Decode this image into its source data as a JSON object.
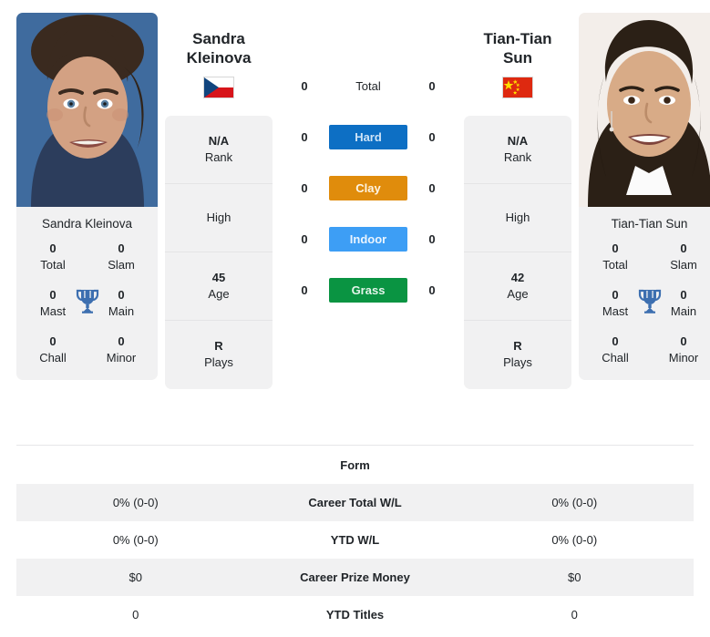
{
  "players": {
    "left": {
      "first_name": "Sandra",
      "last_name": "Kleinova",
      "full_name": "Sandra Kleinova",
      "display_name": "Sandra\nKleinova",
      "flag": "czech-republic-flag",
      "rank": "N/A",
      "rank_label": "Rank",
      "high": "High",
      "age": "45",
      "age_label": "Age",
      "plays": "R",
      "plays_label": "Plays",
      "titles": {
        "total": "0",
        "total_label": "Total",
        "slam": "0",
        "slam_label": "Slam",
        "mast": "0",
        "mast_label": "Mast",
        "main": "0",
        "main_label": "Main",
        "chall": "0",
        "chall_label": "Chall",
        "minor": "0",
        "minor_label": "Minor"
      }
    },
    "right": {
      "first_name": "Tian-Tian",
      "last_name": "Sun",
      "full_name": "Tian-Tian Sun",
      "display_name": "Tian-Tian\nSun",
      "flag": "china-flag",
      "rank": "N/A",
      "rank_label": "Rank",
      "high": "High",
      "age": "42",
      "age_label": "Age",
      "plays": "R",
      "plays_label": "Plays",
      "titles": {
        "total": "0",
        "total_label": "Total",
        "slam": "0",
        "slam_label": "Slam",
        "mast": "0",
        "mast_label": "Mast",
        "main": "0",
        "main_label": "Main",
        "chall": "0",
        "chall_label": "Chall",
        "minor": "0",
        "minor_label": "Minor"
      }
    }
  },
  "surfaces": [
    {
      "label": "Total",
      "left": "0",
      "right": "0",
      "bg": "transparent",
      "fg": "#212529",
      "plain": true
    },
    {
      "label": "Hard",
      "left": "0",
      "right": "0",
      "bg": "#0d6fc4",
      "fg": "#cfe4f7",
      "plain": false
    },
    {
      "label": "Clay",
      "left": "0",
      "right": "0",
      "bg": "#e08c0c",
      "fg": "#fdf4e4",
      "plain": false
    },
    {
      "label": "Indoor",
      "left": "0",
      "right": "0",
      "bg": "#3d9ef5",
      "fg": "#eaf4fe",
      "plain": false
    },
    {
      "label": "Grass",
      "left": "0",
      "right": "0",
      "bg": "#0a9442",
      "fg": "#e4f4ea",
      "plain": false
    }
  ],
  "form_table": {
    "header_label": "Form",
    "rows": [
      {
        "left": "0% (0-0)",
        "label": "Career Total W/L",
        "right": "0% (0-0)"
      },
      {
        "left": "0% (0-0)",
        "label": "YTD W/L",
        "right": "0% (0-0)"
      },
      {
        "left": "$0",
        "label": "Career Prize Money",
        "right": "$0"
      },
      {
        "left": "0",
        "label": "YTD Titles",
        "right": "0"
      }
    ]
  },
  "colors": {
    "panel_bg": "#f1f1f2",
    "trophy": "#3d6fb0",
    "hard": "#0d6fc4",
    "clay": "#e08c0c",
    "indoor": "#3d9ef5",
    "grass": "#0a9442"
  }
}
